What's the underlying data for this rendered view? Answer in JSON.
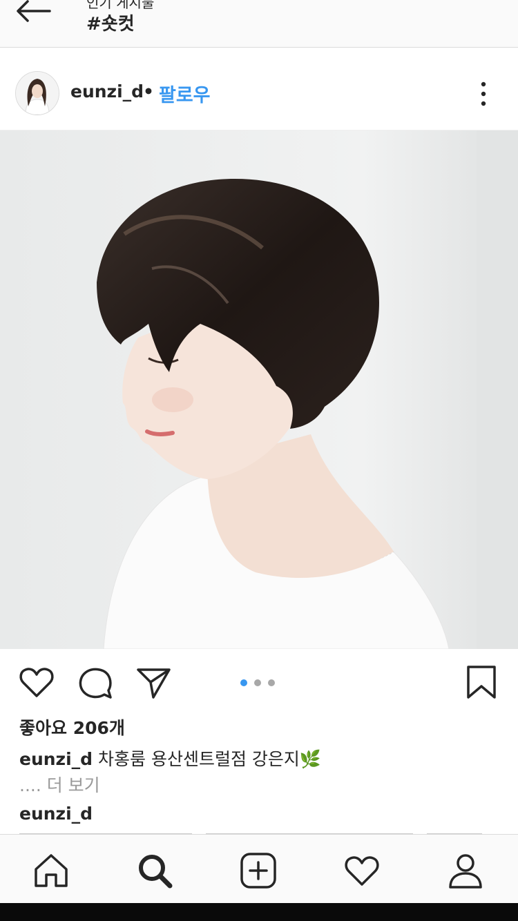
{
  "topbar": {
    "subtitle": "인기 게시물",
    "title": "#숏컷",
    "back_icon": "arrow-left-icon"
  },
  "post": {
    "username": "eunzi_d",
    "separator": "•",
    "follow_label": "팔로우",
    "more_icon": "vertical-ellipsis-icon",
    "photo_desc_icon": "post-photo",
    "carousel": {
      "count": 3,
      "active": 0
    },
    "likes": "좋아요 206개",
    "caption_user": "eunzi_d",
    "caption_text": " 차홍룸 용산센트럴점 강은지🌿",
    "more_link": ".... 더 보기",
    "comment_user": "eunzi_d"
  },
  "colors": {
    "accent": "#3897f0",
    "text": "#262626",
    "muted": "#999999"
  },
  "tabbar": {
    "items": [
      "home-icon",
      "search-icon",
      "add-post-icon",
      "activity-heart-icon",
      "profile-icon"
    ],
    "active": "search-icon"
  }
}
